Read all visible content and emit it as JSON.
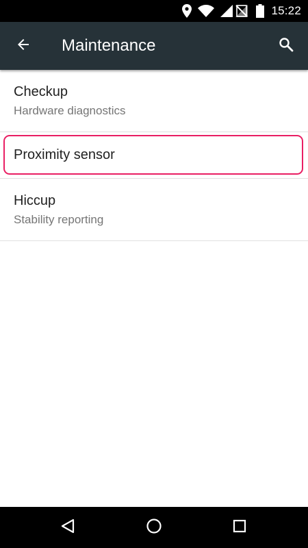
{
  "status_bar": {
    "time": "15:22",
    "icons": [
      "location-icon",
      "wifi-icon",
      "signal-icon",
      "no-sim-icon",
      "battery-icon"
    ]
  },
  "app_bar": {
    "title": "Maintenance",
    "background": "#263238",
    "icons": [
      "back-arrow-icon",
      "search-icon"
    ]
  },
  "list": {
    "items": [
      {
        "title": "Checkup",
        "subtitle": "Hardware diagnostics"
      },
      {
        "title": "Proximity sensor"
      },
      {
        "title": "Hiccup",
        "subtitle": "Stability reporting"
      }
    ],
    "highlight_color": "#e91e63"
  },
  "nav_bar": {
    "icons": [
      "back-triangle-icon",
      "home-circle-icon",
      "recents-square-icon"
    ]
  }
}
